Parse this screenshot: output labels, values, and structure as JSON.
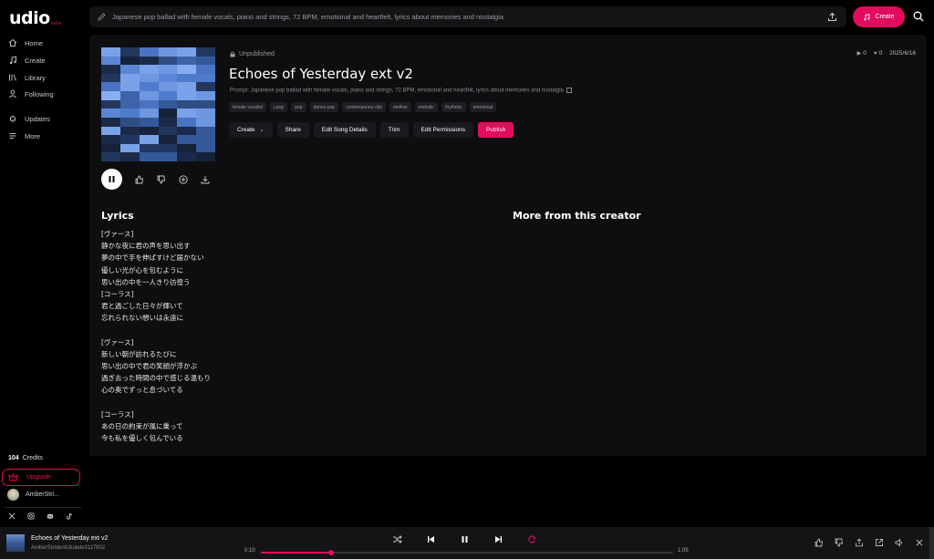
{
  "app": {
    "logo": "udio",
    "beta_label": "beta"
  },
  "colors": {
    "accent": "#e30b5c",
    "panel_bg": "#0e0e10"
  },
  "sidebar": {
    "items": [
      {
        "label": "Home",
        "icon": "home-icon"
      },
      {
        "label": "Create",
        "icon": "music-note-icon"
      },
      {
        "label": "Library",
        "icon": "library-icon"
      },
      {
        "label": "Following",
        "icon": "user-icon"
      },
      {
        "label": "Updates",
        "icon": "bell-icon"
      },
      {
        "label": "More",
        "icon": "menu-icon"
      }
    ],
    "credits_count": "104",
    "credits_label": "Credits",
    "upgrade_label": "Upgrade",
    "username": "AmberStri...",
    "socials": [
      "x-icon",
      "instagram-icon",
      "discord-icon",
      "tiktok-icon"
    ]
  },
  "header": {
    "prompt_text": "Japanese pop ballad with female vocals, piano and strings, 72 BPM, emotional and heartfelt, lyrics about memories and nostalgia",
    "create_label": "Create"
  },
  "song": {
    "status": "Unpublished",
    "title": "Echoes of Yesterday ext v2",
    "plays": "0",
    "likes": "0",
    "date": "2025/6/16",
    "prompt": "Prompt: Japanese pop ballad with female vocals, piano and strings, 72 BPM, emotional and heartfelt, lyrics about memories and nostalgia",
    "tags": [
      "female vocalist",
      "j-pop",
      "pop",
      "dance-pop",
      "contemporary r&b",
      "mellow",
      "melodic",
      "rhythmic",
      "emotional"
    ],
    "actions": {
      "create": "Create",
      "share": "Share",
      "edit_details": "Edit Song Details",
      "trim": "Trim",
      "edit_permissions": "Edit Permissions",
      "publish": "Publish"
    }
  },
  "lyrics": {
    "heading": "Lyrics",
    "lines": [
      "[ヴァース]",
      "静かな夜に君の声を思い出す",
      "夢の中で手を伸ばすけど届かない",
      "優しい光が心を包むように",
      "思い出の中を一人きり彷徨う",
      "[コーラス]",
      "君と過ごした日々が輝いて",
      "忘れられない想いは永遠に",
      "",
      "[ヴァース]",
      "新しい朝が訪れるたびに",
      "思い出の中で君の笑顔が浮かぶ",
      "過ぎ去った時間の中で感じる温もり",
      "心の奥でずっと息づいてる",
      "",
      "[コーラス]",
      "あの日の約束が風に乗って",
      "今も私を優しく包んでいる"
    ]
  },
  "more_from_creator": {
    "heading": "More from this creator"
  },
  "player": {
    "title": "Echoes of Yesterday ext v2",
    "artist": "AmberStridentUkulele3117802",
    "current_time": "0:10",
    "total_time": "1:05",
    "progress": 0.17
  }
}
